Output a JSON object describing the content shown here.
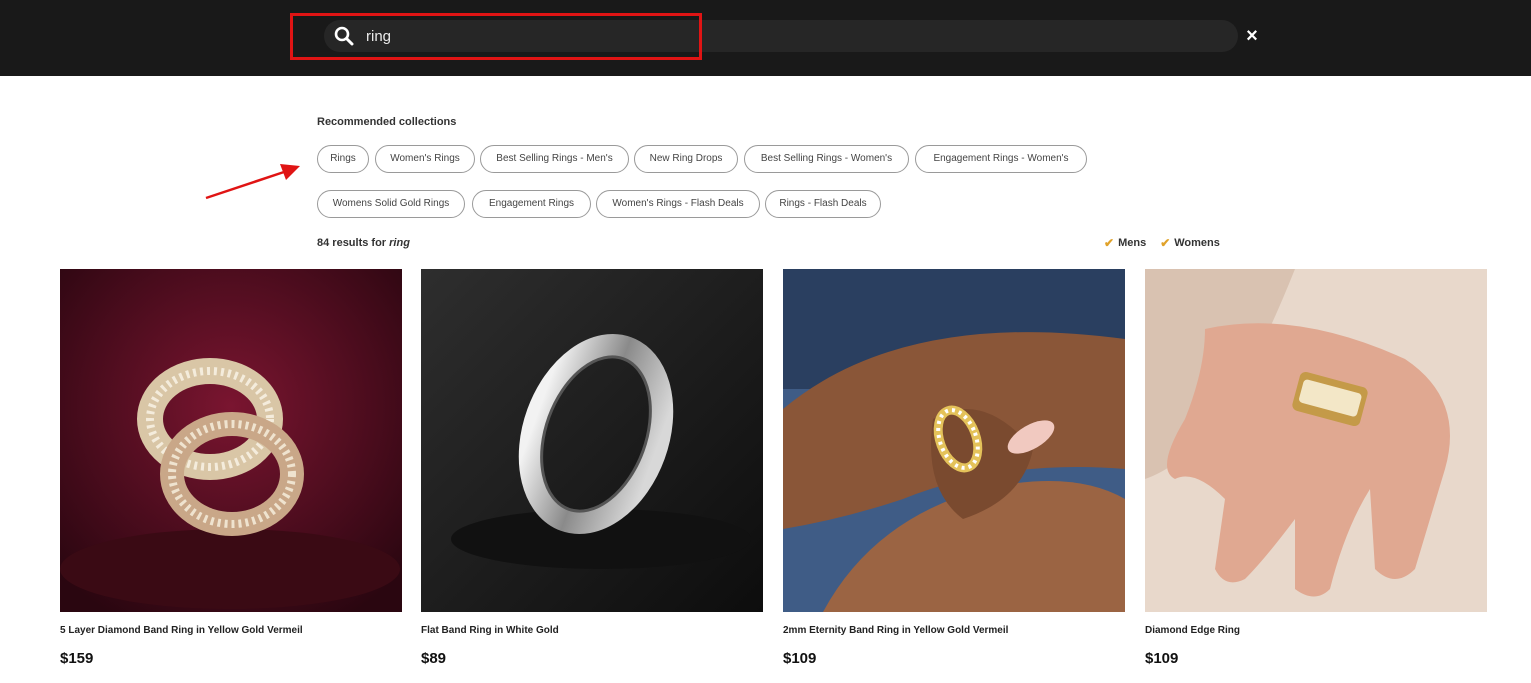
{
  "search": {
    "value": "ring",
    "close_label": "×"
  },
  "recommended": {
    "heading": "Recommended collections",
    "chips": [
      "Rings",
      "Women's Rings",
      "Best Selling Rings - Men's",
      "New Ring Drops",
      "Best Selling Rings - Women's",
      "Engagement Rings - Women's",
      "Womens Solid Gold Rings",
      "Engagement Rings",
      "Women's Rings - Flash Deals",
      "Rings - Flash Deals"
    ]
  },
  "results": {
    "count_text": "84 results for",
    "query": "ring"
  },
  "filters": [
    {
      "label": "Mens",
      "checked": true
    },
    {
      "label": "Womens",
      "checked": true
    }
  ],
  "products": [
    {
      "name": "5 Layer Diamond Band Ring in Yellow Gold Vermeil",
      "price": "$159"
    },
    {
      "name": "Flat Band Ring in White Gold",
      "price": "$89"
    },
    {
      "name": "2mm Eternity Band Ring in Yellow Gold Vermeil",
      "price": "$109"
    },
    {
      "name": "Diamond Edge Ring",
      "price": "$109"
    }
  ],
  "colors": {
    "topbar": "#191919",
    "accent_check": "#e0a22a",
    "annotation_red": "#e01414"
  }
}
